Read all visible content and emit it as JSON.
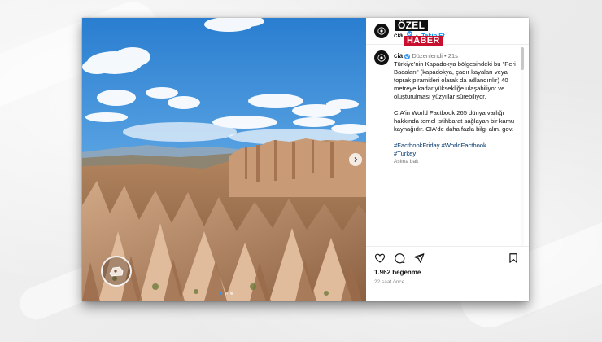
{
  "badge": {
    "top": "ÖZEL",
    "bottom": "HABER"
  },
  "post": {
    "header": {
      "username": "cia",
      "separator": "•",
      "follow_label": "Takip Et"
    },
    "caption": {
      "username": "cia",
      "edited": "Düzenlendi",
      "separator": "•",
      "age": "21s",
      "paragraph1": "Türkiye'nin Kapadokya bölgesindeki bu \"Peri Bacaları\" (kapadokya, çadır kayaları veya toprak piramitleri olarak da adlandırılır) 40 metreye kadar yüksekliğe ulaşabiliyor ve oluşturulması yüzyıllar sürebiliyor.",
      "paragraph2": "CIA'in World Factbook 265 dünya varlığı hakkında temel istihbarat sağlayan bir kamu kaynağıdır. CIA'de daha fazla bilgi alın. gov.",
      "hashtags_line1": "#FactbookFriday #WorldFactbook",
      "hashtags_line2": "#Turkey",
      "see_translation": "Aslına bak"
    },
    "likes": "1.962 beğenme",
    "time_ago": "22 saat önce",
    "carousel": {
      "total": 3,
      "active_index": 0
    },
    "icons": {
      "like": "heart-icon",
      "comment": "comment-icon",
      "share": "share-icon",
      "save": "bookmark-icon",
      "next": "chevron-right-icon",
      "tag": "tag-icon"
    },
    "colors": {
      "accent": "#0095f6",
      "verified": "#3797f0",
      "badge_red": "#c8102e"
    }
  }
}
